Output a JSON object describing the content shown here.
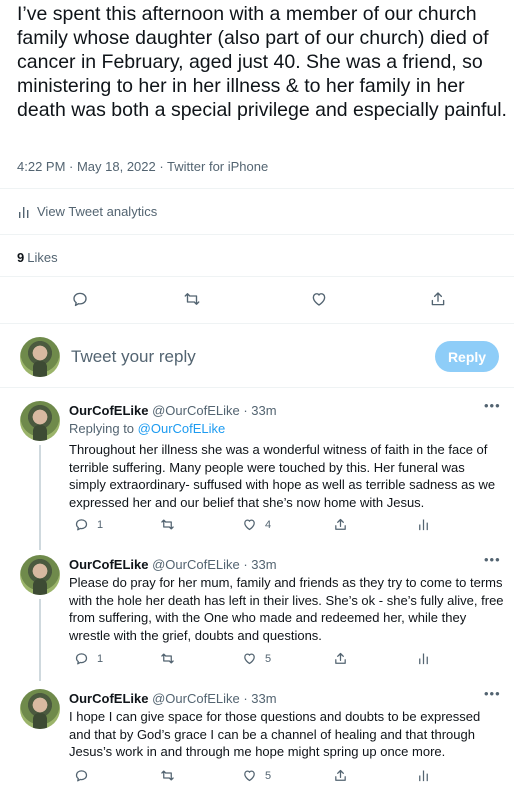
{
  "tweet": {
    "text": "I’ve spent this afternoon with a member of our church family whose daughter (also part of our church) died of cancer in February, aged just 40. She was a friend, so ministering to her in her illness & to her family in her death was both a special privilege and especially painful.",
    "meta": "4:22 PM · May 18, 2022 · Twitter for iPhone",
    "analytics_label": "View Tweet analytics",
    "likes_count": "9",
    "likes_label": "Likes"
  },
  "compose": {
    "placeholder": "Tweet your reply",
    "reply_button": "Reply"
  },
  "replies": [
    {
      "name": "OurCofELike",
      "handle": "@OurCofELike · 33m",
      "replying_prefix": "Replying to ",
      "replying_to": "@OurCofELike",
      "text": "Throughout her illness she was a wonderful witness of faith in the face of terrible suffering. Many people were touched by this. Her funeral was simply extraordinary- suffused with hope as well as terrible sadness as we expressed her and our belief that she’s now home with Jesus.",
      "reply_count": "1",
      "like_count": "4"
    },
    {
      "name": "OurCofELike",
      "handle": "@OurCofELike · 33m",
      "text": "Please do pray for her mum, family and friends as they try to come to terms with the hole her death has left in their lives. She’s ok - she’s fully alive, free from suffering, with the One who made and redeemed her, while they wrestle with the grief, doubts and questions.",
      "reply_count": "1",
      "like_count": "5"
    },
    {
      "name": "OurCofELike",
      "handle": "@OurCofELike · 33m",
      "text": "I hope I can give space for those questions and doubts to be expressed and that by God’s grace I can be a channel of healing and that through Jesus’s work in and through me hope might spring up once more.",
      "reply_count": "",
      "like_count": "5"
    }
  ],
  "more_label": "•••",
  "colors": {
    "accent": "#1d9bf0",
    "reply_button_disabled": "#8ecdf8",
    "secondary_text": "#536471"
  }
}
